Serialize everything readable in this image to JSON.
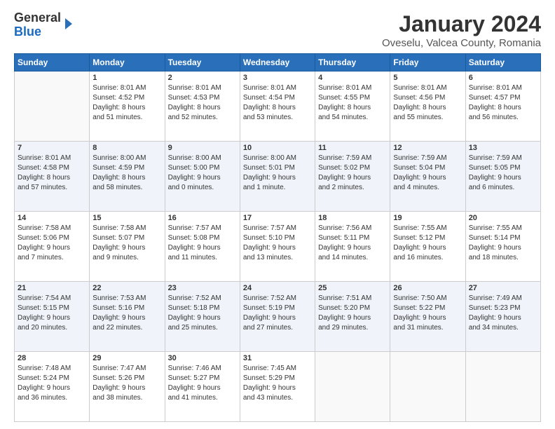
{
  "logo": {
    "general": "General",
    "blue": "Blue"
  },
  "title": "January 2024",
  "subtitle": "Oveselu, Valcea County, Romania",
  "weekdays": [
    "Sunday",
    "Monday",
    "Tuesday",
    "Wednesday",
    "Thursday",
    "Friday",
    "Saturday"
  ],
  "weeks": [
    [
      {
        "day": "",
        "info": ""
      },
      {
        "day": "1",
        "info": "Sunrise: 8:01 AM\nSunset: 4:52 PM\nDaylight: 8 hours\nand 51 minutes."
      },
      {
        "day": "2",
        "info": "Sunrise: 8:01 AM\nSunset: 4:53 PM\nDaylight: 8 hours\nand 52 minutes."
      },
      {
        "day": "3",
        "info": "Sunrise: 8:01 AM\nSunset: 4:54 PM\nDaylight: 8 hours\nand 53 minutes."
      },
      {
        "day": "4",
        "info": "Sunrise: 8:01 AM\nSunset: 4:55 PM\nDaylight: 8 hours\nand 54 minutes."
      },
      {
        "day": "5",
        "info": "Sunrise: 8:01 AM\nSunset: 4:56 PM\nDaylight: 8 hours\nand 55 minutes."
      },
      {
        "day": "6",
        "info": "Sunrise: 8:01 AM\nSunset: 4:57 PM\nDaylight: 8 hours\nand 56 minutes."
      }
    ],
    [
      {
        "day": "7",
        "info": "Sunrise: 8:01 AM\nSunset: 4:58 PM\nDaylight: 8 hours\nand 57 minutes."
      },
      {
        "day": "8",
        "info": "Sunrise: 8:00 AM\nSunset: 4:59 PM\nDaylight: 8 hours\nand 58 minutes."
      },
      {
        "day": "9",
        "info": "Sunrise: 8:00 AM\nSunset: 5:00 PM\nDaylight: 9 hours\nand 0 minutes."
      },
      {
        "day": "10",
        "info": "Sunrise: 8:00 AM\nSunset: 5:01 PM\nDaylight: 9 hours\nand 1 minute."
      },
      {
        "day": "11",
        "info": "Sunrise: 7:59 AM\nSunset: 5:02 PM\nDaylight: 9 hours\nand 2 minutes."
      },
      {
        "day": "12",
        "info": "Sunrise: 7:59 AM\nSunset: 5:04 PM\nDaylight: 9 hours\nand 4 minutes."
      },
      {
        "day": "13",
        "info": "Sunrise: 7:59 AM\nSunset: 5:05 PM\nDaylight: 9 hours\nand 6 minutes."
      }
    ],
    [
      {
        "day": "14",
        "info": "Sunrise: 7:58 AM\nSunset: 5:06 PM\nDaylight: 9 hours\nand 7 minutes."
      },
      {
        "day": "15",
        "info": "Sunrise: 7:58 AM\nSunset: 5:07 PM\nDaylight: 9 hours\nand 9 minutes."
      },
      {
        "day": "16",
        "info": "Sunrise: 7:57 AM\nSunset: 5:08 PM\nDaylight: 9 hours\nand 11 minutes."
      },
      {
        "day": "17",
        "info": "Sunrise: 7:57 AM\nSunset: 5:10 PM\nDaylight: 9 hours\nand 13 minutes."
      },
      {
        "day": "18",
        "info": "Sunrise: 7:56 AM\nSunset: 5:11 PM\nDaylight: 9 hours\nand 14 minutes."
      },
      {
        "day": "19",
        "info": "Sunrise: 7:55 AM\nSunset: 5:12 PM\nDaylight: 9 hours\nand 16 minutes."
      },
      {
        "day": "20",
        "info": "Sunrise: 7:55 AM\nSunset: 5:14 PM\nDaylight: 9 hours\nand 18 minutes."
      }
    ],
    [
      {
        "day": "21",
        "info": "Sunrise: 7:54 AM\nSunset: 5:15 PM\nDaylight: 9 hours\nand 20 minutes."
      },
      {
        "day": "22",
        "info": "Sunrise: 7:53 AM\nSunset: 5:16 PM\nDaylight: 9 hours\nand 22 minutes."
      },
      {
        "day": "23",
        "info": "Sunrise: 7:52 AM\nSunset: 5:18 PM\nDaylight: 9 hours\nand 25 minutes."
      },
      {
        "day": "24",
        "info": "Sunrise: 7:52 AM\nSunset: 5:19 PM\nDaylight: 9 hours\nand 27 minutes."
      },
      {
        "day": "25",
        "info": "Sunrise: 7:51 AM\nSunset: 5:20 PM\nDaylight: 9 hours\nand 29 minutes."
      },
      {
        "day": "26",
        "info": "Sunrise: 7:50 AM\nSunset: 5:22 PM\nDaylight: 9 hours\nand 31 minutes."
      },
      {
        "day": "27",
        "info": "Sunrise: 7:49 AM\nSunset: 5:23 PM\nDaylight: 9 hours\nand 34 minutes."
      }
    ],
    [
      {
        "day": "28",
        "info": "Sunrise: 7:48 AM\nSunset: 5:24 PM\nDaylight: 9 hours\nand 36 minutes."
      },
      {
        "day": "29",
        "info": "Sunrise: 7:47 AM\nSunset: 5:26 PM\nDaylight: 9 hours\nand 38 minutes."
      },
      {
        "day": "30",
        "info": "Sunrise: 7:46 AM\nSunset: 5:27 PM\nDaylight: 9 hours\nand 41 minutes."
      },
      {
        "day": "31",
        "info": "Sunrise: 7:45 AM\nSunset: 5:29 PM\nDaylight: 9 hours\nand 43 minutes."
      },
      {
        "day": "",
        "info": ""
      },
      {
        "day": "",
        "info": ""
      },
      {
        "day": "",
        "info": ""
      }
    ]
  ]
}
